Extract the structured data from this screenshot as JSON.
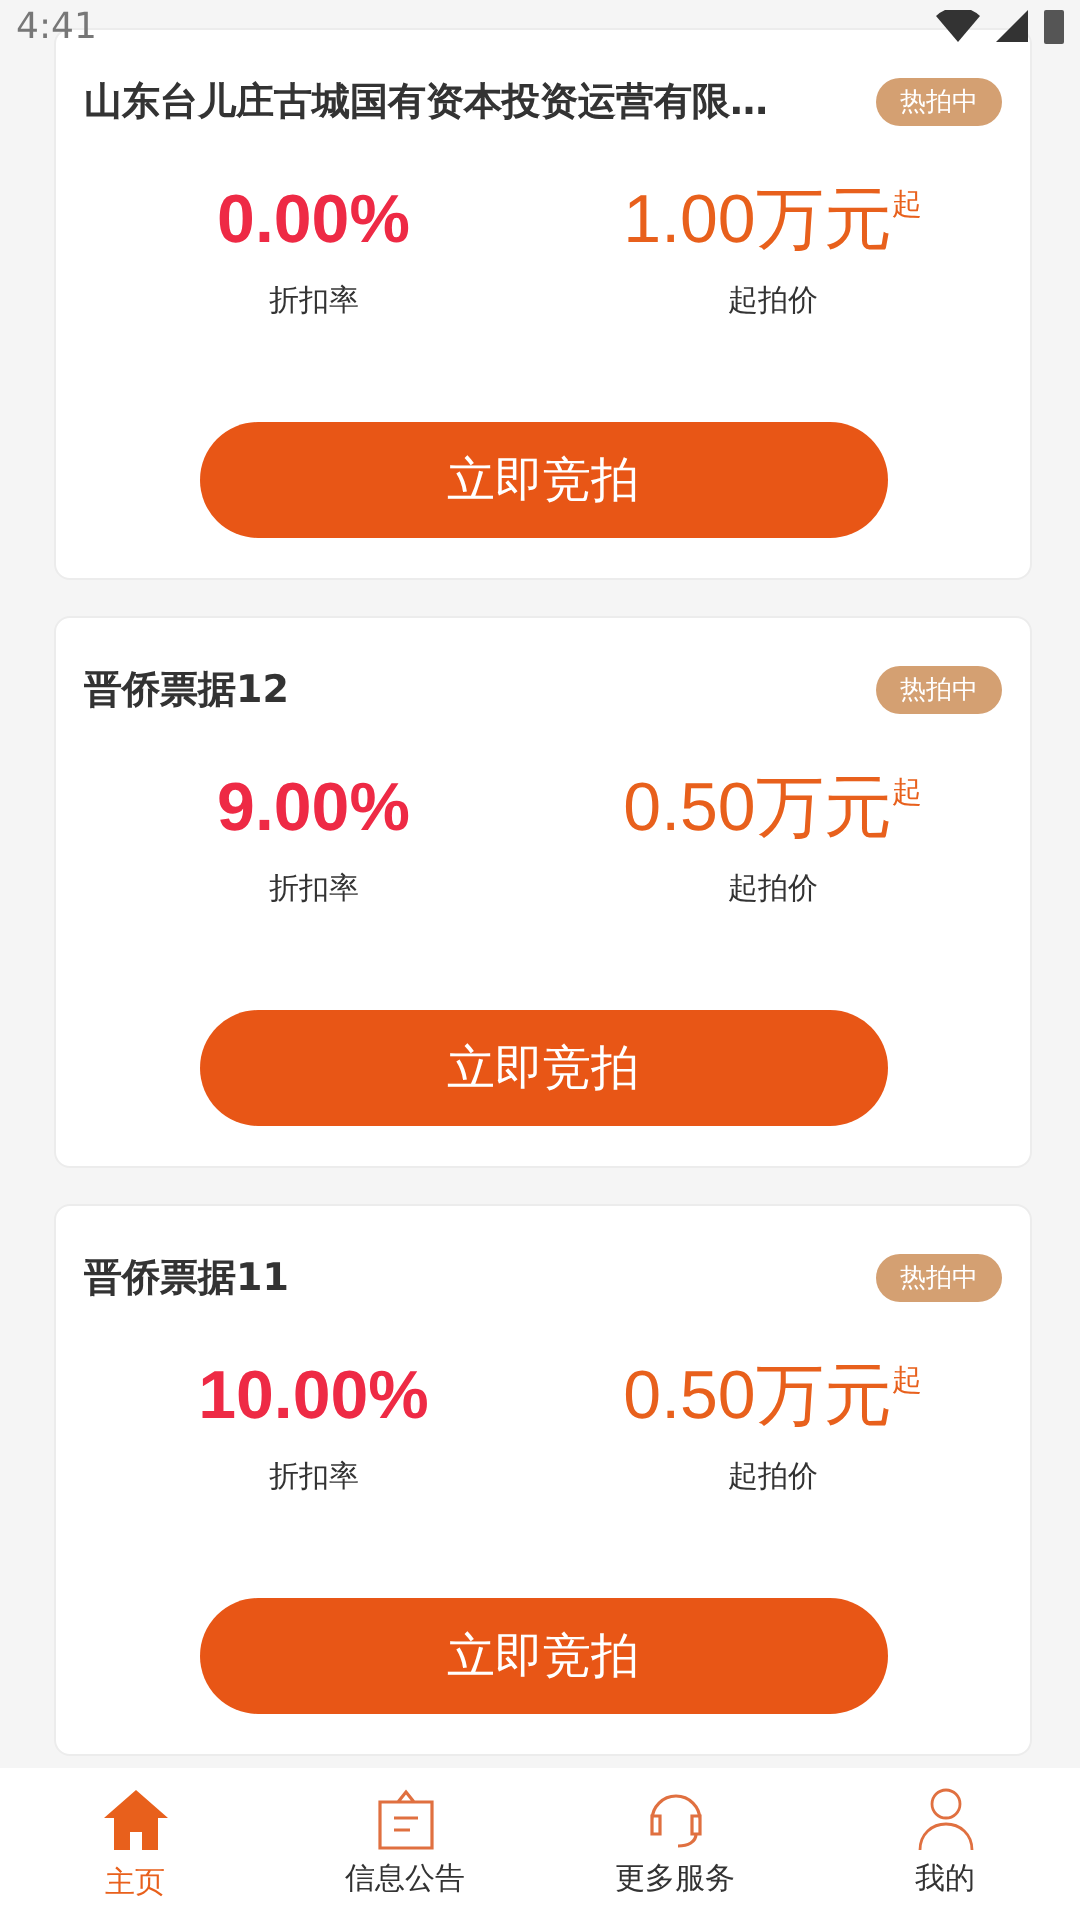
{
  "status_bar": {
    "time": "4:41"
  },
  "auctions": [
    {
      "title": "山东台儿庄古城国有资本投资运营有限…",
      "badge": "热拍中",
      "discount": "0.00%",
      "discount_label": "折扣率",
      "price": "1.00万元",
      "price_suffix": "起",
      "price_label": "起拍价",
      "button": "立即竞拍"
    },
    {
      "title": "晋侨票据12",
      "badge": "热拍中",
      "discount": "9.00%",
      "discount_label": "折扣率",
      "price": "0.50万元",
      "price_suffix": "起",
      "price_label": "起拍价",
      "button": "立即竞拍"
    },
    {
      "title": "晋侨票据11",
      "badge": "热拍中",
      "discount": "10.00%",
      "discount_label": "折扣率",
      "price": "0.50万元",
      "price_suffix": "起",
      "price_label": "起拍价",
      "button": "立即竞拍"
    }
  ],
  "bottom_nav": [
    {
      "label": "主页",
      "kind": "home",
      "selected": true
    },
    {
      "label": "信息公告",
      "kind": "notice",
      "selected": false
    },
    {
      "label": "更多服务",
      "kind": "service",
      "selected": false
    },
    {
      "label": "我的",
      "kind": "profile",
      "selected": false
    }
  ]
}
